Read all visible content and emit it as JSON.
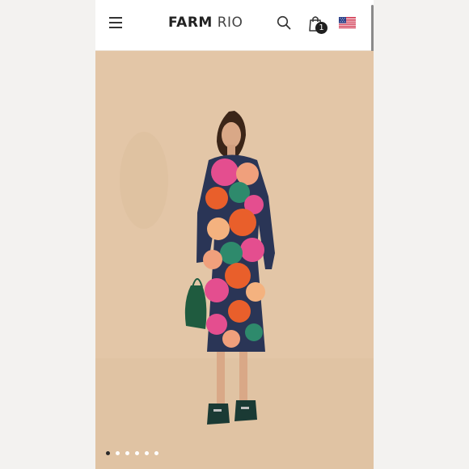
{
  "header": {
    "brand_bold": "FARM",
    "brand_light": "RIO",
    "cart_count": "1",
    "menu_icon": "hamburger-menu-icon",
    "search_icon": "search-icon",
    "bag_icon": "shopping-bag-icon",
    "flag_icon": "us-flag-icon"
  },
  "gallery": {
    "image_count": 6,
    "active_index": 0,
    "background_color": "#e3c6a7"
  },
  "colors": {
    "header_bg": "#ffffff",
    "dot_active": "#2a2a2a",
    "dot_inactive": "#ffffff"
  }
}
